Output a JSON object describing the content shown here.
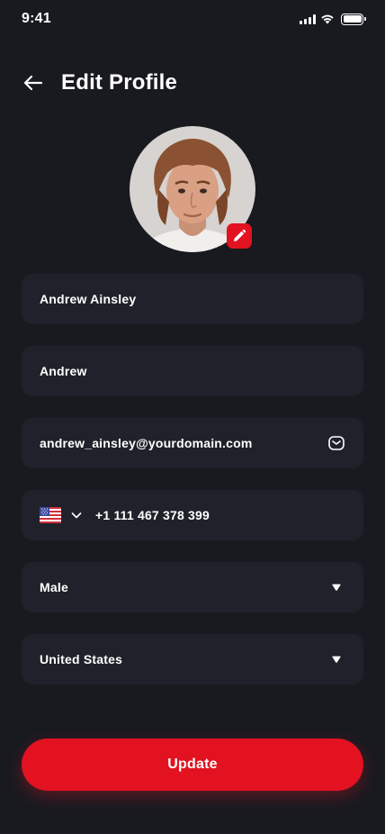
{
  "status_bar": {
    "time": "9:41"
  },
  "header": {
    "title": "Edit Profile"
  },
  "form": {
    "full_name": "Andrew Ainsley",
    "nickname": "Andrew",
    "email": "andrew_ainsley@yourdomain.com",
    "phone": {
      "country_flag": "us-flag",
      "number": "+1 111 467 378 399"
    },
    "gender": "Male",
    "country": "United States"
  },
  "actions": {
    "update_label": "Update"
  },
  "colors": {
    "background": "#181A20",
    "field": "#1F222A",
    "accent": "#E21221",
    "text": "#FFFFFF"
  }
}
